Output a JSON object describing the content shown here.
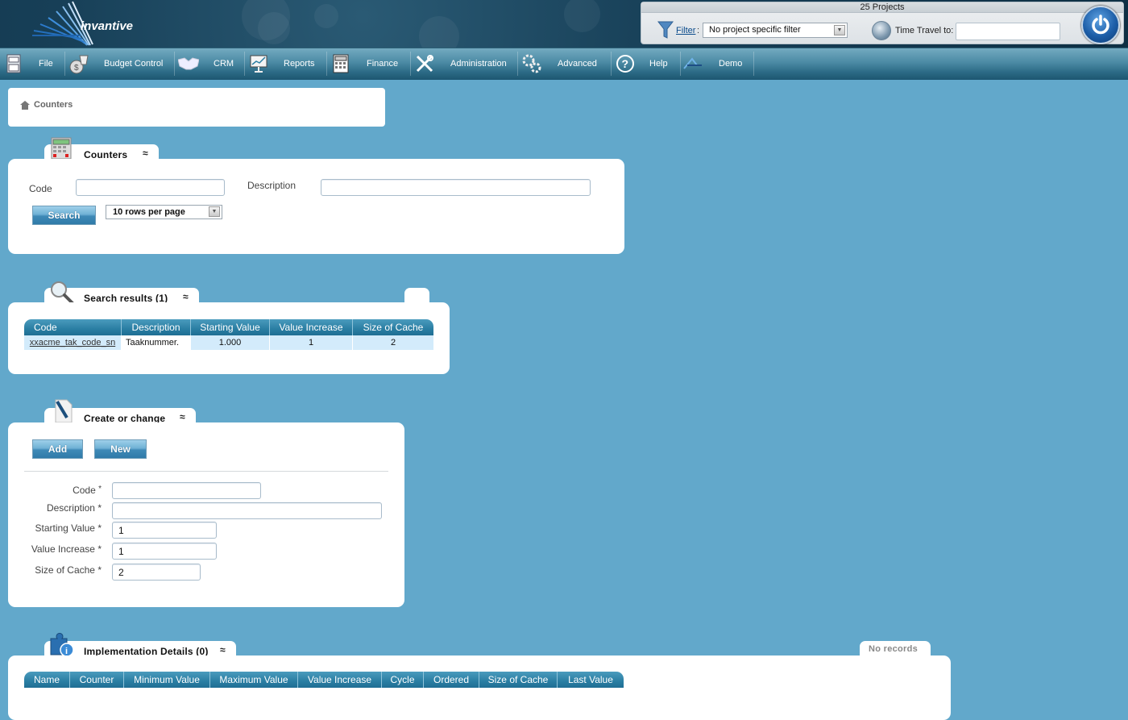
{
  "app": {
    "logo_text": "invantive"
  },
  "project_panel": {
    "count_label": "25 Projects",
    "filter_link": "Filter",
    "filter_colon": ":",
    "filter_value": "No project specific filter",
    "time_travel_label": "Time Travel to:",
    "time_travel_value": ""
  },
  "menu": {
    "items": [
      {
        "label": "File",
        "icon": "file-cabinet-icon"
      },
      {
        "label": "Budget Control",
        "icon": "money-bag-icon"
      },
      {
        "label": "CRM",
        "icon": "handshake-icon"
      },
      {
        "label": "Reports",
        "icon": "presentation-board-icon"
      },
      {
        "label": "Finance",
        "icon": "calculator-icon"
      },
      {
        "label": "Administration",
        "icon": "tools-icon"
      },
      {
        "label": "Advanced",
        "icon": "gears-icon"
      },
      {
        "label": "Help",
        "icon": "question-icon"
      },
      {
        "label": "Demo",
        "icon": "demo-logo-icon"
      }
    ]
  },
  "breadcrumb": {
    "current": "Counters"
  },
  "search_panel": {
    "title": "Counters",
    "code_label": "Code",
    "code_value": "",
    "description_label": "Description",
    "description_value": "",
    "search_button": "Search",
    "rows_per_page": "10 rows per page"
  },
  "results_panel": {
    "title": "Search results (1)",
    "columns": [
      "Code",
      "Description",
      "Starting Value",
      "Value Increase",
      "Size of Cache"
    ],
    "rows": [
      {
        "code": "xxacme_tak_code_sn",
        "description": "Taaknummer.",
        "starting_value": "1.000",
        "value_increase": "1",
        "size_of_cache": "2"
      }
    ]
  },
  "edit_panel": {
    "title": "Create or change",
    "add_button": "Add",
    "new_button": "New",
    "required_marker": "*",
    "fields": [
      {
        "label": "Code",
        "value": ""
      },
      {
        "label": "Description",
        "value": ""
      },
      {
        "label": "Starting Value",
        "value": "1"
      },
      {
        "label": "Value Increase",
        "value": "1"
      },
      {
        "label": "Size of Cache",
        "value": "2"
      }
    ]
  },
  "impl_panel": {
    "title": "Implementation Details (0)",
    "status": "No records",
    "columns": [
      "Name",
      "Counter",
      "Minimum Value",
      "Maximum Value",
      "Value Increase",
      "Cycle",
      "Ordered",
      "Size of Cache",
      "Last Value"
    ]
  },
  "colors": {
    "background": "#62a8cb",
    "header_dark": "#0e2f44",
    "grid_header": "#2a7ea3",
    "grid_row": "#d3ebfb",
    "button": "#3f8ab7"
  }
}
